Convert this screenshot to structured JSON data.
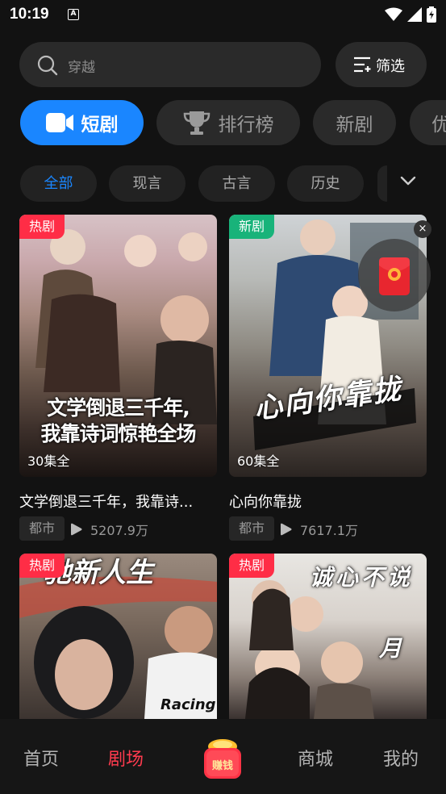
{
  "status_bar": {
    "time": "10:19",
    "notification_glyph": "A"
  },
  "search": {
    "placeholder": "穿越",
    "filter_label": "筛选"
  },
  "category_tabs": [
    {
      "label": "短剧",
      "icon": "video-camera-icon",
      "active": true
    },
    {
      "label": "排行榜",
      "icon": "trophy-icon",
      "active": false
    },
    {
      "label": "新剧",
      "active": false
    },
    {
      "label": "优",
      "active": false
    }
  ],
  "sub_tabs": [
    "全部",
    "现言",
    "古言",
    "历史"
  ],
  "cards": [
    {
      "badge": "热剧",
      "badge_type": "hot",
      "poster_text_1": "文学倒退三千年,",
      "poster_text_2": "我靠诗词惊艳全场",
      "episodes": "30集全",
      "title": "文学倒退三千年，我靠诗...",
      "genre": "都市",
      "plays": "5207.9万"
    },
    {
      "badge": "新剧",
      "badge_type": "new",
      "poster_text_1": "心向你靠拢",
      "episodes": "60集全",
      "title": "心向你靠拢",
      "genre": "都市",
      "plays": "7617.1万"
    },
    {
      "badge": "热剧",
      "badge_type": "hot",
      "poster_text_1": "驰新人生",
      "poster_text_2": "Racing"
    },
    {
      "badge": "热剧",
      "badge_type": "hot",
      "poster_text_1": "诚心不说",
      "poster_text_2": "月"
    }
  ],
  "close_label": "×",
  "bottom_nav": [
    {
      "label": "首页",
      "active": false
    },
    {
      "label": "剧场",
      "active": true
    },
    {
      "label": "赚钱",
      "active": false
    },
    {
      "label": "商城",
      "active": false
    },
    {
      "label": "我的",
      "active": false
    }
  ],
  "colors": {
    "accent": "#1a86ff",
    "hot": "#ff2d46",
    "new": "#18b37a",
    "nav_active": "#ff3b4e"
  }
}
